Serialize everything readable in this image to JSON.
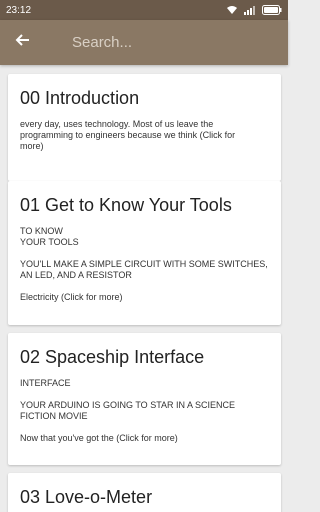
{
  "status": {
    "time": "23:12",
    "icons": [
      "wifi-icon",
      "signal-icon",
      "battery-icon"
    ]
  },
  "search": {
    "placeholder": "Search..."
  },
  "cards": [
    {
      "title": "00 Introduction",
      "lines": [
        "every day, uses technology. Most of us leave the",
        "programming to engineers because we think (Click for",
        "more)"
      ]
    },
    {
      "title": "01 Get to Know Your Tools",
      "lines": [
        "TO KNOW",
        "YOUR TOOLS",
        "",
        "YOU'LL MAKE A SIMPLE CIRCUIT WITH SOME SWITCHES,",
        "AN LED, AND A RESISTOR",
        "",
        "Electricity (Click for more)"
      ]
    },
    {
      "title": "02 Spaceship Interface",
      "lines": [
        "INTERFACE",
        "",
        "YOUR ARDUINO IS GOING TO STAR IN A SCIENCE",
        "FICTION MOVIE",
        "",
        "Now that you've got the (Click for more)"
      ]
    },
    {
      "title": "03 Love-o-Meter",
      "lines": []
    }
  ],
  "colors": {
    "status_bar": "#6b5a4a",
    "app_bar": "#8a7864",
    "background": "#ececec"
  }
}
